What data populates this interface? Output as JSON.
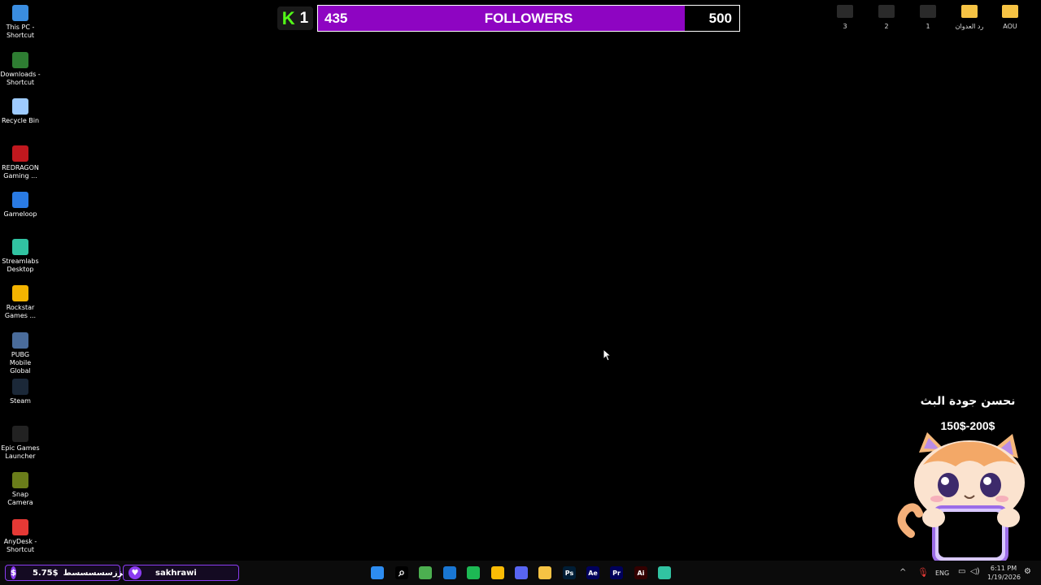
{
  "desktop_icons": [
    {
      "label": "This PC - Shortcut",
      "icon": "computer-icon",
      "color": "#3a8de0"
    },
    {
      "label": "Downloads - Shortcut",
      "icon": "download-icon",
      "color": "#2e7d32"
    },
    {
      "label": "Recycle Bin",
      "icon": "recycle-bin-icon",
      "color": "#9ecbff"
    },
    {
      "label": "REDRAGON Gaming ...",
      "icon": "redragon-icon",
      "color": "#c0181e"
    },
    {
      "label": "Gameloop",
      "icon": "gameloop-icon",
      "color": "#2a7be4"
    },
    {
      "label": "Streamlabs Desktop",
      "icon": "streamlabs-icon",
      "color": "#31c3a2"
    },
    {
      "label": "Rockstar Games ...",
      "icon": "rockstar-icon",
      "color": "#f4b400"
    },
    {
      "label": "PUBG Mobile Global",
      "icon": "pubg-icon",
      "color": "#4a6c9b"
    },
    {
      "label": "Steam",
      "icon": "steam-icon",
      "color": "#1b2838"
    },
    {
      "label": "Epic Games Launcher",
      "icon": "epic-icon",
      "color": "#222"
    },
    {
      "label": "Snap Camera",
      "icon": "snap-camera-icon",
      "color": "#6a7d1a"
    },
    {
      "label": "AnyDesk - Shortcut",
      "icon": "anydesk-icon",
      "color": "#e53935"
    }
  ],
  "top_right_icons": [
    {
      "label": "3",
      "icon": "file-icon"
    },
    {
      "label": "2",
      "icon": "file-icon"
    },
    {
      "label": "1",
      "icon": "file-icon"
    },
    {
      "label": "رد العدوان",
      "icon": "folder-icon"
    },
    {
      "label": "AOU",
      "icon": "folder-icon"
    }
  ],
  "goal": {
    "badge_letter": "K",
    "badge_number": "1",
    "current": "435",
    "title": "FOLLOWERS",
    "target": "500",
    "progress": 0.87,
    "fill_color": "#8e05c2",
    "accent": "#53fc18"
  },
  "promo": {
    "title": "نحسن جودة البث",
    "price": "150$-200$"
  },
  "taskbar": {
    "donation_pill": {
      "symbol": "$",
      "amount": "5.75$",
      "name": "بززسسسسسط"
    },
    "follower_pill": {
      "name": "sakhrawi"
    },
    "apps": [
      {
        "name": "start-icon",
        "label": "",
        "color": "#2d8cf0"
      },
      {
        "name": "search-icon",
        "label": "",
        "color": "#000"
      },
      {
        "name": "minecraft-icon",
        "label": "",
        "color": "#4caf50"
      },
      {
        "name": "app-icon",
        "label": "",
        "color": "#1976d2"
      },
      {
        "name": "spotify-icon",
        "label": "",
        "color": "#1db954"
      },
      {
        "name": "chrome-icon",
        "label": "",
        "color": "#fbbc05"
      },
      {
        "name": "discord-icon",
        "label": "",
        "color": "#5865f2"
      },
      {
        "name": "file-explorer-icon",
        "label": "",
        "color": "#f6c344"
      },
      {
        "name": "photoshop-icon",
        "label": "Ps",
        "color": "#001e36"
      },
      {
        "name": "after-effects-icon",
        "label": "Ae",
        "color": "#00005b"
      },
      {
        "name": "premiere-icon",
        "label": "Pr",
        "color": "#00005b"
      },
      {
        "name": "illustrator-icon",
        "label": "Ai",
        "color": "#330000"
      },
      {
        "name": "streamlabs-taskbar-icon",
        "label": "",
        "color": "#31c3a2"
      }
    ],
    "tray": {
      "language": "ENG",
      "time": "6:11 PM",
      "date": "1/19/2026"
    }
  }
}
